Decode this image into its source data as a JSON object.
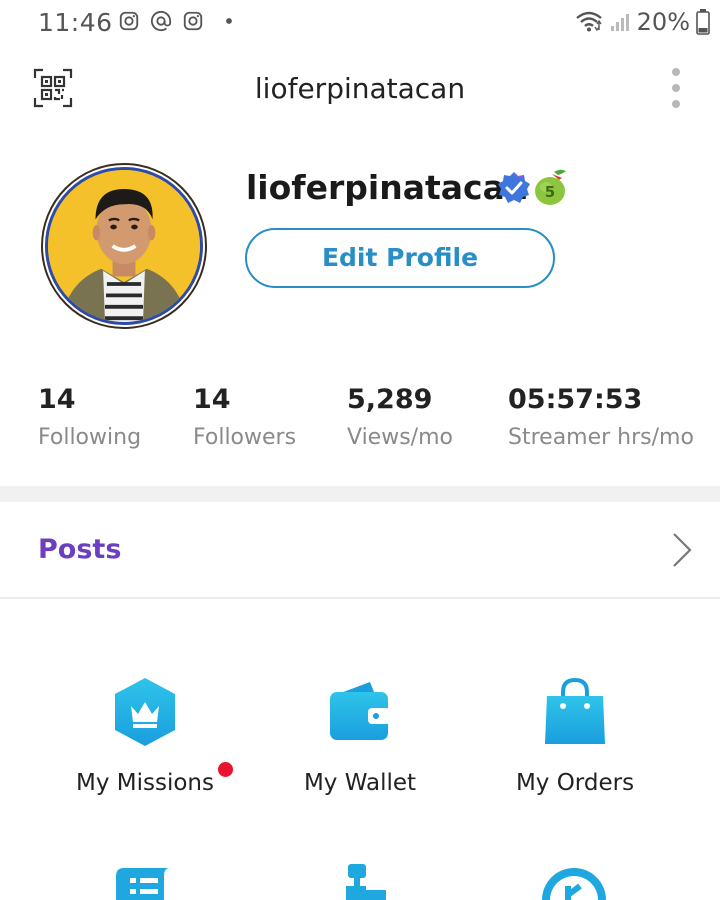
{
  "status_bar": {
    "time": "11:46",
    "battery": "20%"
  },
  "header": {
    "title": "lioferpinatacan"
  },
  "profile": {
    "username": "lioferpinatacan",
    "level_badge": "5",
    "edit_button": "Edit Profile"
  },
  "stats": [
    {
      "value": "14",
      "label": "Following"
    },
    {
      "value": "14",
      "label": "Followers"
    },
    {
      "value": "5,289",
      "label": "Views/mo"
    },
    {
      "value": "05:57:53",
      "label": "Streamer hrs/mo"
    }
  ],
  "posts": {
    "label": "Posts"
  },
  "menu": [
    {
      "label": "My Missions",
      "icon": "crown-hexagon-icon",
      "has_notification": true
    },
    {
      "label": "My Wallet",
      "icon": "wallet-icon",
      "has_notification": false
    },
    {
      "label": "My Orders",
      "icon": "shopping-bag-icon",
      "has_notification": false
    }
  ],
  "colors": {
    "accent_blue": "#2a8ec6",
    "posts_purple": "#6b3fc0",
    "icon_cyan": "#1fa8e0",
    "notification_red": "#e8132c"
  }
}
